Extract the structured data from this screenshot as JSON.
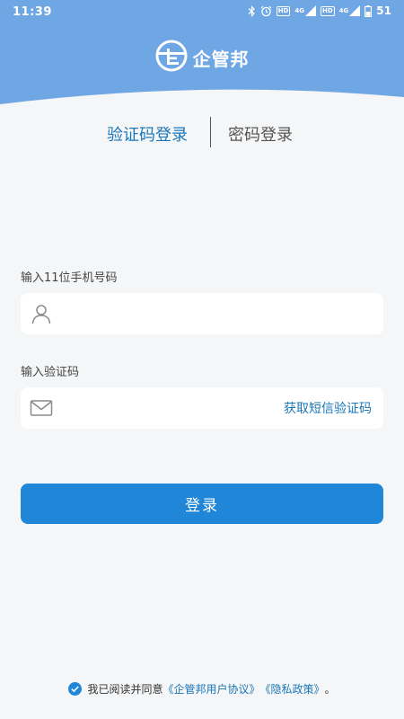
{
  "status_bar": {
    "time": "11:39",
    "network_1": "4G",
    "network_2": "4G",
    "battery": "51"
  },
  "brand": {
    "name": "企管邦"
  },
  "tabs": {
    "sms_login": "验证码登录",
    "password_login": "密码登录",
    "active": "sms_login"
  },
  "form": {
    "phone_label": "输入11位手机号码",
    "phone_value": "",
    "code_label": "输入验证码",
    "code_value": "",
    "get_code": "获取短信验证码"
  },
  "login_button": "登录",
  "agreement": {
    "checked": true,
    "prefix": "我已阅读并同意",
    "user_agreement": "《企管邦用户协议》",
    "privacy_policy": "《隐私政策》",
    "suffix": "。"
  },
  "colors": {
    "header_blue": "#6fa6e4",
    "accent": "#1b77b8",
    "button": "#1f86d8",
    "background": "#f5f6f7"
  }
}
